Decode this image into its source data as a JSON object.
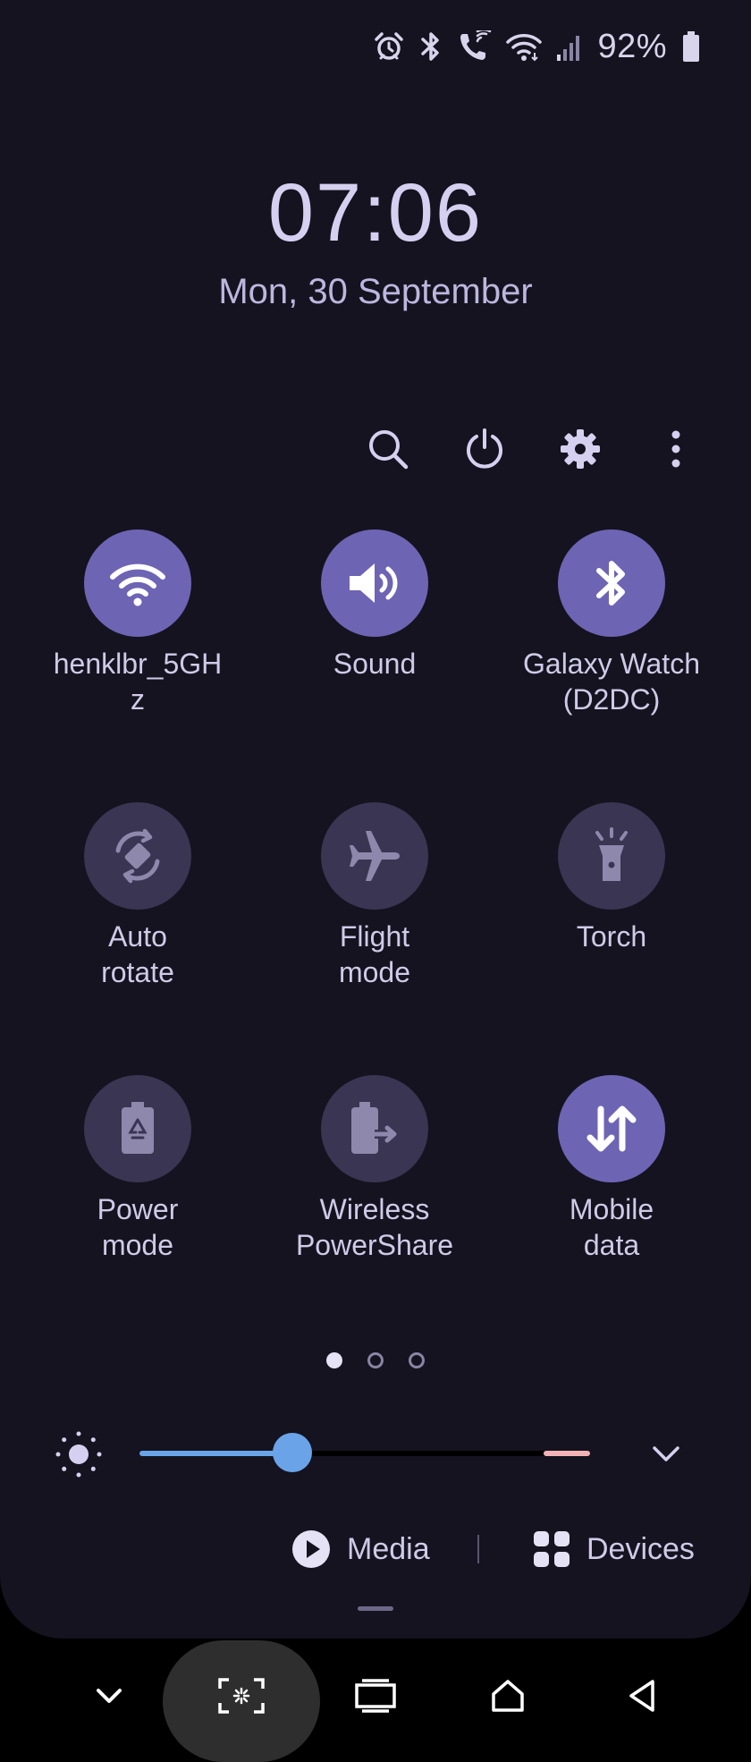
{
  "status_bar": {
    "icons": [
      "alarm-icon",
      "bluetooth-icon",
      "wifi-calling-icon",
      "wifi-icon",
      "cellular-signal-icon",
      "battery-icon"
    ],
    "battery_percent": "92%"
  },
  "clock": {
    "time": "07:06",
    "date": "Mon, 30 September"
  },
  "actions": [
    "search-icon",
    "power-icon",
    "settings-gear-icon",
    "more-options-icon"
  ],
  "tiles": [
    {
      "label": "henklbr_5GH z",
      "icon": "wifi-icon",
      "state": "on"
    },
    {
      "label": "Sound",
      "icon": "speaker-icon",
      "state": "on"
    },
    {
      "label": "Galaxy Watch (D2DC)",
      "icon": "bluetooth-icon",
      "state": "on"
    },
    {
      "label": "Auto rotate",
      "icon": "auto-rotate-icon",
      "state": "off"
    },
    {
      "label": "Flight mode",
      "icon": "airplane-icon",
      "state": "off"
    },
    {
      "label": "Torch",
      "icon": "torch-icon",
      "state": "off"
    },
    {
      "label": "Power mode",
      "icon": "power-mode-battery-icon",
      "state": "off"
    },
    {
      "label": "Wireless PowerShare",
      "icon": "powershare-icon",
      "state": "off"
    },
    {
      "label": "Mobile data",
      "icon": "mobile-data-icon",
      "state": "on"
    }
  ],
  "page_indicator": {
    "pages": 3,
    "current": 1
  },
  "brightness": {
    "level": 0.34,
    "icon": "brightness-icon",
    "expand_icon": "chevron-down-icon"
  },
  "media": {
    "label": "Media",
    "icon": "play-circle-icon"
  },
  "devices": {
    "label": "Devices",
    "icon": "devices-grid-icon"
  },
  "navigation_bar": [
    "hide-keyboard-chevron-icon",
    "screenshot-capture-icon",
    "recent-apps-icon",
    "home-icon",
    "back-icon"
  ],
  "colors": {
    "panel_bg": "#14131f",
    "tile_on": "#6e64b4",
    "tile_off": "#3a3552",
    "slider_fill": "#6aa3e8",
    "slider_warn": "#f3b3b6"
  }
}
